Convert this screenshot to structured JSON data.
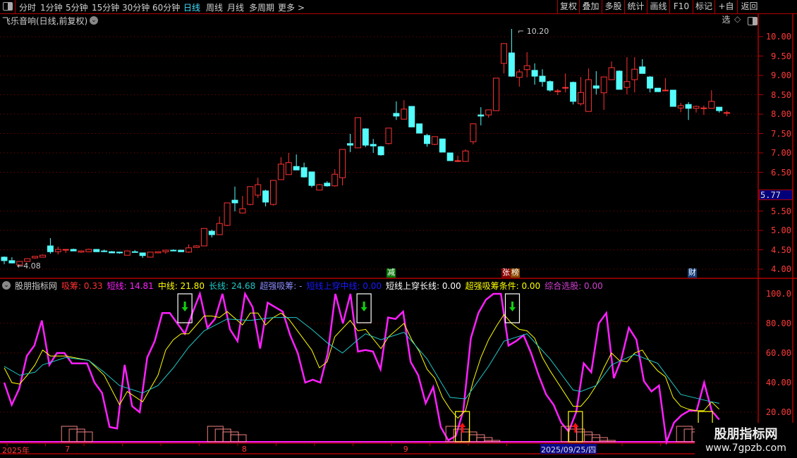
{
  "toolbar": {
    "periods": [
      "分时",
      "1分钟",
      "5分钟",
      "15分钟",
      "30分钟",
      "60分钟",
      "日线",
      "周线",
      "月线",
      "多周期",
      "更多 >"
    ],
    "active_period": "日线",
    "buttons": [
      "复权",
      "叠加",
      "多股",
      "统计",
      "画线",
      "F10",
      "标记",
      "+自选",
      "返回"
    ]
  },
  "chart": {
    "title": "飞乐音响(日线,前复权)",
    "price_axis": [
      "10.00",
      "9.50",
      "9.00",
      "8.50",
      "8.00",
      "7.50",
      "7.00",
      "6.50",
      "5.50",
      "5.00",
      "4.50",
      "4.00"
    ],
    "cursor_price": "5.77",
    "high_label": "10.20",
    "low_label": "4.08",
    "markers": [
      {
        "text": "减",
        "color": "#0a7a0a"
      },
      {
        "text": "张",
        "color": "#8b0000"
      },
      {
        "text": "榜",
        "color": "#8b4a00"
      },
      {
        "text": "财",
        "color": "#143c78"
      }
    ],
    "colors": {
      "up": "#ff3232",
      "down": "#54fcfc",
      "grid": "#8b0000"
    },
    "candles": [
      [
        4.31,
        4.33,
        4.13,
        4.22
      ],
      [
        4.22,
        4.31,
        4.15,
        4.16
      ],
      [
        4.11,
        4.2,
        4.08,
        4.2
      ],
      [
        4.2,
        4.27,
        4.19,
        4.27
      ],
      [
        4.29,
        4.33,
        4.27,
        4.33
      ],
      [
        4.31,
        4.38,
        4.3,
        4.36
      ],
      [
        4.6,
        4.8,
        4.4,
        4.45
      ],
      [
        4.45,
        4.58,
        4.38,
        4.51
      ],
      [
        4.49,
        4.51,
        4.42,
        4.51
      ],
      [
        4.51,
        4.53,
        4.47,
        4.47
      ],
      [
        4.44,
        4.47,
        4.42,
        4.47
      ],
      [
        4.45,
        4.53,
        4.44,
        4.51
      ],
      [
        4.51,
        4.51,
        4.45,
        4.45
      ],
      [
        4.47,
        4.51,
        4.44,
        4.46
      ],
      [
        4.45,
        4.47,
        4.42,
        4.42
      ],
      [
        4.44,
        4.45,
        4.4,
        4.42
      ],
      [
        4.36,
        4.47,
        4.36,
        4.47
      ],
      [
        4.45,
        4.49,
        4.44,
        4.44
      ],
      [
        4.42,
        4.42,
        4.29,
        4.35
      ],
      [
        4.31,
        4.44,
        4.31,
        4.44
      ],
      [
        4.42,
        4.45,
        4.42,
        4.45
      ],
      [
        4.45,
        4.49,
        4.4,
        4.49
      ],
      [
        4.49,
        4.51,
        4.47,
        4.47
      ],
      [
        4.49,
        4.49,
        4.45,
        4.45
      ],
      [
        4.44,
        4.64,
        4.42,
        4.55
      ],
      [
        4.56,
        4.62,
        4.55,
        4.6
      ],
      [
        4.6,
        5.05,
        4.6,
        5.05
      ],
      [
        4.98,
        5.02,
        4.82,
        4.89
      ],
      [
        4.89,
        5.36,
        4.89,
        5.18
      ],
      [
        5.13,
        5.71,
        5.11,
        5.71
      ],
      [
        5.78,
        6.13,
        5.49,
        5.71
      ],
      [
        5.45,
        5.89,
        5.45,
        5.56
      ],
      [
        5.67,
        6.13,
        5.65,
        6.13
      ],
      [
        5.91,
        6.36,
        5.84,
        6.18
      ],
      [
        6.02,
        6.05,
        5.62,
        5.73
      ],
      [
        5.67,
        6.29,
        5.64,
        6.29
      ],
      [
        6.31,
        6.89,
        6.31,
        6.71
      ],
      [
        6.44,
        7.0,
        6.44,
        6.75
      ],
      [
        6.65,
        6.96,
        6.56,
        6.56
      ],
      [
        6.62,
        6.75,
        6.36,
        6.38
      ],
      [
        6.51,
        6.51,
        6.11,
        6.16
      ],
      [
        6.04,
        6.2,
        6.04,
        6.18
      ],
      [
        6.22,
        6.27,
        6.13,
        6.15
      ],
      [
        6.15,
        6.58,
        6.13,
        6.45
      ],
      [
        6.36,
        7.09,
        6.16,
        7.09
      ],
      [
        7.24,
        7.49,
        7.02,
        7.2
      ],
      [
        7.13,
        7.91,
        7.13,
        7.91
      ],
      [
        7.62,
        7.64,
        7.15,
        7.2
      ],
      [
        7.22,
        7.36,
        7.0,
        7.18
      ],
      [
        7.16,
        7.18,
        6.93,
        6.95
      ],
      [
        7.24,
        7.64,
        7.22,
        7.64
      ],
      [
        8.02,
        8.33,
        7.85,
        7.95
      ],
      [
        7.87,
        8.36,
        7.87,
        8.13
      ],
      [
        8.2,
        8.2,
        7.67,
        7.67
      ],
      [
        7.75,
        7.75,
        7.51,
        7.51
      ],
      [
        7.45,
        7.49,
        7.16,
        7.24
      ],
      [
        7.22,
        7.42,
        7.2,
        7.42
      ],
      [
        7.36,
        7.36,
        7.02,
        7.02
      ],
      [
        7.0,
        7.0,
        6.8,
        6.8
      ],
      [
        6.78,
        6.93,
        6.76,
        6.8
      ],
      [
        6.78,
        7.09,
        6.78,
        7.05
      ],
      [
        7.29,
        7.75,
        7.22,
        7.75
      ],
      [
        7.98,
        8.18,
        7.71,
        7.95
      ],
      [
        7.98,
        8.11,
        7.91,
        8.11
      ],
      [
        8.09,
        8.93,
        8.09,
        8.93
      ],
      [
        9.31,
        9.82,
        9.05,
        9.82
      ],
      [
        9.58,
        10.2,
        8.96,
        8.98
      ],
      [
        8.95,
        9.16,
        8.71,
        9.09
      ],
      [
        9.15,
        9.6,
        8.95,
        9.25
      ],
      [
        9.13,
        9.31,
        8.76,
        8.98
      ],
      [
        8.98,
        9.16,
        8.71,
        8.84
      ],
      [
        8.84,
        8.87,
        8.58,
        8.62
      ],
      [
        8.58,
        8.65,
        8.49,
        8.6
      ],
      [
        8.67,
        9.05,
        8.56,
        8.69
      ],
      [
        8.82,
        8.84,
        8.25,
        8.33
      ],
      [
        8.27,
        8.96,
        8.22,
        8.56
      ],
      [
        8.07,
        9.18,
        8.07,
        8.89
      ],
      [
        8.73,
        9.11,
        8.51,
        8.67
      ],
      [
        8.55,
        8.96,
        8.11,
        8.96
      ],
      [
        8.89,
        9.36,
        8.89,
        9.2
      ],
      [
        9.11,
        9.13,
        8.64,
        8.64
      ],
      [
        8.69,
        9.47,
        8.51,
        8.84
      ],
      [
        8.89,
        9.47,
        8.56,
        9.16
      ],
      [
        9.22,
        9.42,
        9.05,
        9.05
      ],
      [
        8.96,
        8.98,
        8.56,
        8.67
      ],
      [
        8.67,
        8.67,
        8.58,
        8.58
      ],
      [
        8.6,
        8.93,
        8.6,
        8.62
      ],
      [
        8.62,
        8.62,
        8.2,
        8.2
      ],
      [
        8.16,
        8.29,
        8.05,
        8.22
      ],
      [
        8.25,
        8.31,
        7.85,
        8.15
      ],
      [
        8.15,
        8.22,
        8.04,
        8.2
      ],
      [
        8.15,
        8.22,
        7.98,
        8.16
      ],
      [
        8.15,
        8.62,
        8.15,
        8.33
      ],
      [
        8.18,
        8.18,
        8.04,
        8.09
      ],
      [
        8.04,
        8.09,
        7.95,
        8.04
      ]
    ]
  },
  "indicator": {
    "name": "股朋指标网",
    "legend": [
      {
        "label": "吸筹: 0.33",
        "color": "#ff3232"
      },
      {
        "label": "短线: 14.81",
        "color": "#ff20ff"
      },
      {
        "label": "中线: 21.80",
        "color": "#ffff00"
      },
      {
        "label": "长线: 24.68",
        "color": "#20c8c8"
      },
      {
        "label": "超强吸筹: -",
        "color": "#8c8cff"
      },
      {
        "label": "短线上穿中线: 0.00",
        "color": "#1a1aff"
      },
      {
        "label": "短线上穿长线: 0.00",
        "color": "#ffffff"
      },
      {
        "label": "超强吸筹条件: 0.00",
        "color": "#ffff00"
      },
      {
        "label": "综合选股: 0.00",
        "color": "#d040d0"
      }
    ],
    "axis": [
      "100.0",
      "80.00",
      "60.00",
      "40.00",
      "20.00"
    ],
    "short_line": [
      40,
      25,
      36,
      58,
      65,
      82,
      52,
      60,
      60,
      53,
      53,
      53,
      40,
      33,
      10,
      9,
      52,
      24,
      20,
      57,
      68,
      87,
      87,
      80,
      73,
      87,
      100,
      77,
      83,
      100,
      76,
      68,
      100,
      91,
      63,
      94,
      91,
      88,
      72,
      60,
      40,
      42,
      40,
      60,
      100,
      80,
      100,
      61,
      62,
      61,
      49,
      84,
      83,
      88,
      54,
      45,
      26,
      37,
      10,
      1,
      4,
      21,
      70,
      87,
      96,
      100,
      100,
      65,
      68,
      72,
      60,
      45,
      32,
      25,
      13,
      7,
      20,
      53,
      47,
      80,
      87,
      43,
      56,
      77,
      69,
      41,
      34,
      38,
      0,
      13,
      18,
      21,
      21,
      40,
      21,
      15
    ],
    "mid_line": [
      [
        0,
        50
      ],
      [
        1,
        40
      ],
      [
        2,
        39
      ],
      [
        3,
        45
      ],
      [
        4,
        52
      ],
      [
        5,
        62
      ],
      [
        6,
        58
      ],
      [
        8,
        58
      ],
      [
        11,
        55
      ],
      [
        13,
        45
      ],
      [
        15,
        25
      ],
      [
        16,
        34
      ],
      [
        18,
        27
      ],
      [
        20,
        45
      ],
      [
        21,
        62
      ],
      [
        22,
        69
      ],
      [
        23,
        73
      ],
      [
        24,
        73
      ],
      [
        26,
        85
      ],
      [
        27,
        85
      ],
      [
        28,
        84
      ],
      [
        29,
        88
      ],
      [
        31,
        79
      ],
      [
        32,
        87
      ],
      [
        33,
        87
      ],
      [
        34,
        79
      ],
      [
        35,
        84
      ],
      [
        36,
        87
      ],
      [
        37,
        83
      ],
      [
        40,
        62
      ],
      [
        41,
        50
      ],
      [
        42,
        54
      ],
      [
        43,
        71
      ],
      [
        45,
        82
      ],
      [
        46,
        75
      ],
      [
        47,
        76
      ],
      [
        49,
        63
      ],
      [
        50,
        71
      ],
      [
        52,
        80
      ],
      [
        53,
        69
      ],
      [
        54,
        61
      ],
      [
        55,
        49
      ],
      [
        56,
        43
      ],
      [
        57,
        30
      ],
      [
        58,
        22
      ],
      [
        59,
        16
      ],
      [
        60,
        21
      ],
      [
        61,
        41
      ],
      [
        62,
        57
      ],
      [
        63,
        69
      ],
      [
        64,
        78
      ],
      [
        65,
        86
      ],
      [
        66,
        80
      ],
      [
        67,
        76
      ],
      [
        68,
        75
      ],
      [
        69,
        70
      ],
      [
        70,
        57
      ],
      [
        71,
        48
      ],
      [
        72,
        40
      ],
      [
        73,
        32
      ],
      [
        74,
        24
      ],
      [
        75,
        24
      ],
      [
        76,
        30
      ],
      [
        77,
        38
      ],
      [
        78,
        50
      ],
      [
        79,
        60
      ],
      [
        80,
        55
      ],
      [
        81,
        54
      ],
      [
        82,
        60
      ],
      [
        83,
        62
      ],
      [
        84,
        54
      ],
      [
        85,
        48
      ],
      [
        86,
        44
      ],
      [
        87,
        30
      ],
      [
        88,
        24
      ],
      [
        89,
        22
      ],
      [
        90,
        21
      ],
      [
        91,
        21
      ],
      [
        92,
        27
      ],
      [
        93,
        22
      ]
    ],
    "long_line": [
      [
        0,
        51
      ],
      [
        2,
        45
      ],
      [
        4,
        47
      ],
      [
        5,
        52
      ],
      [
        8,
        57
      ],
      [
        11,
        55
      ],
      [
        13,
        47
      ],
      [
        15,
        38
      ],
      [
        18,
        33
      ],
      [
        20,
        38
      ],
      [
        22,
        50
      ],
      [
        24,
        64
      ],
      [
        26,
        75
      ],
      [
        29,
        83
      ],
      [
        32,
        82
      ],
      [
        35,
        84
      ],
      [
        38,
        84
      ],
      [
        40,
        76
      ],
      [
        42,
        67
      ],
      [
        44,
        60
      ],
      [
        46,
        69
      ],
      [
        47,
        73
      ],
      [
        49,
        69
      ],
      [
        52,
        74
      ],
      [
        55,
        56
      ],
      [
        58,
        30
      ],
      [
        60,
        29
      ],
      [
        63,
        51
      ],
      [
        65,
        68
      ],
      [
        68,
        73
      ],
      [
        71,
        56
      ],
      [
        74,
        35
      ],
      [
        75,
        34
      ],
      [
        77,
        38
      ],
      [
        79,
        52
      ],
      [
        82,
        59
      ],
      [
        85,
        53
      ],
      [
        88,
        32
      ],
      [
        92,
        27
      ],
      [
        93,
        26
      ]
    ],
    "sell_signals": [
      23.5,
      46.8,
      66.1
    ],
    "buy_signals": [
      59.6,
      74.3
    ],
    "pending_signal": 91.2
  },
  "date_axis": {
    "labels": [
      {
        "text": "2025年",
        "bar": 0
      },
      {
        "text": "7",
        "bar": 8
      },
      {
        "text": "8",
        "bar": 31
      },
      {
        "text": "9",
        "bar": 52
      }
    ],
    "cursor_date": "2025/09/25/四"
  },
  "watermark": {
    "line1": "股朋指标网",
    "line2": "www.7gpzb.com"
  }
}
